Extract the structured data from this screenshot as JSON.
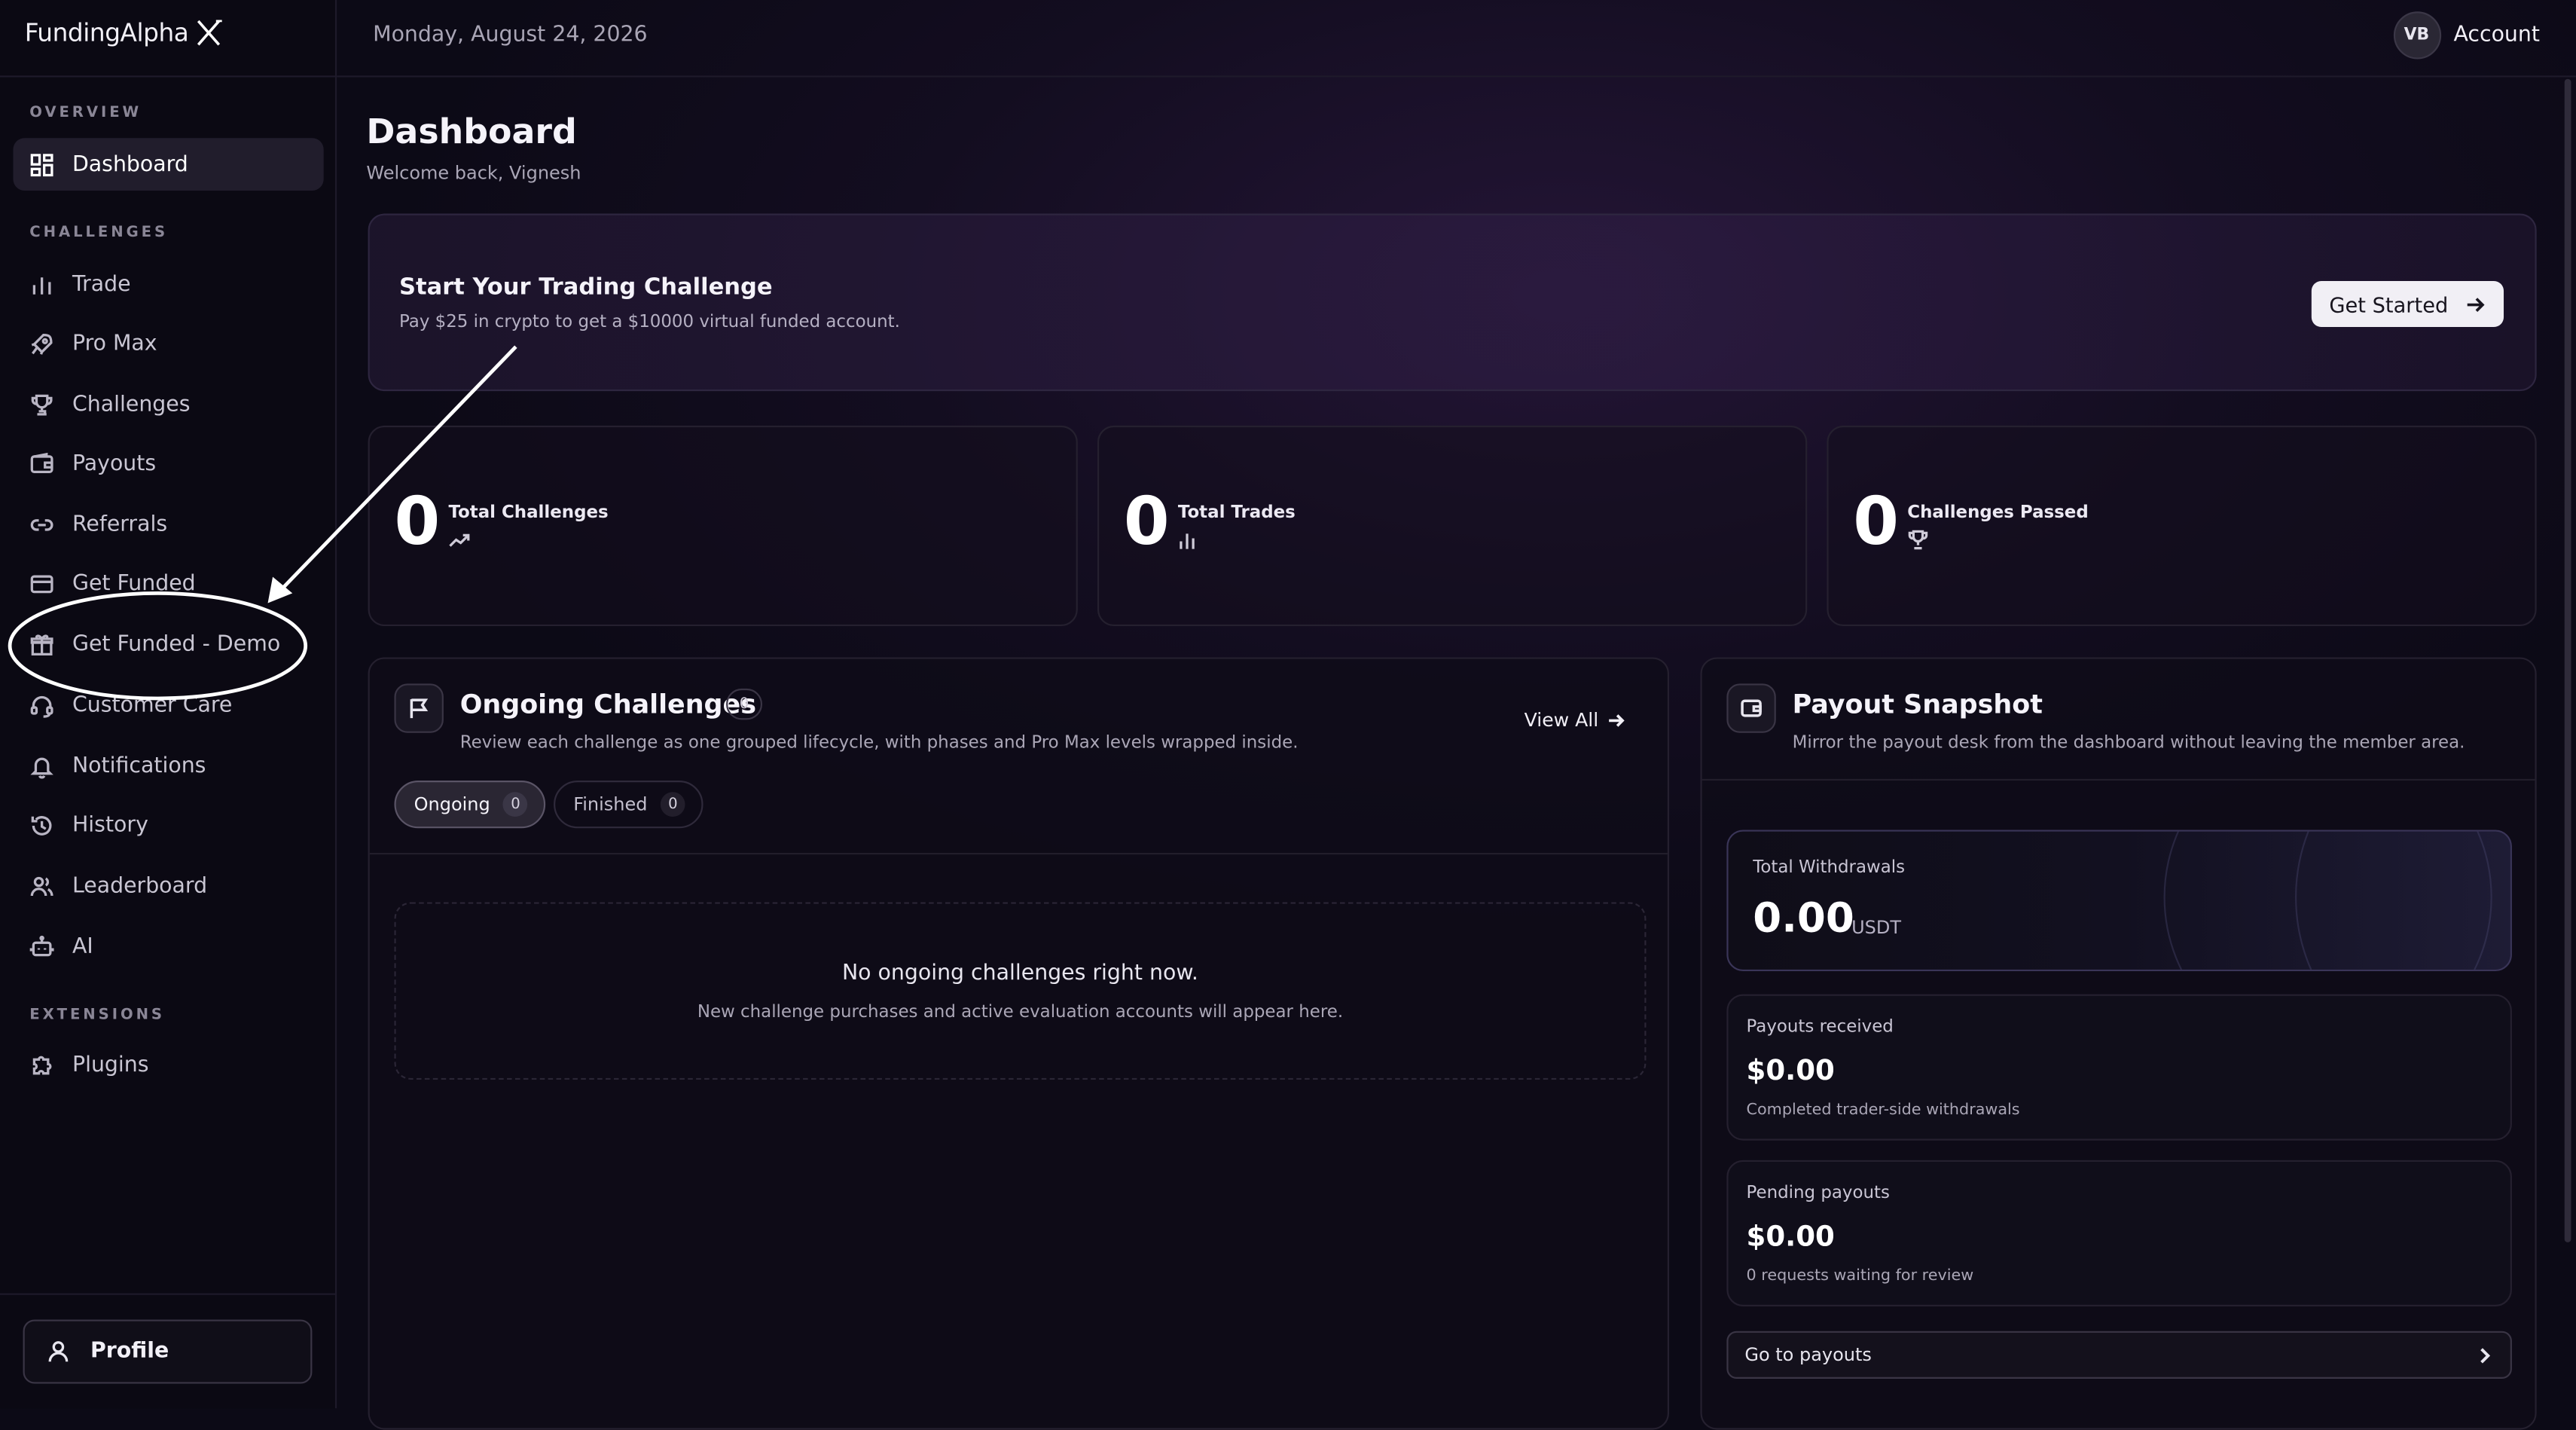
{
  "brand": {
    "name": "FundingAlpha",
    "logo_icon": "x-mark-icon"
  },
  "topbar": {
    "date": "Monday, August 24, 2026",
    "avatar_initials": "VB",
    "account_label": "Account"
  },
  "sidebar": {
    "sections": [
      {
        "label": "OVERVIEW"
      },
      {
        "label": "CHALLENGES"
      },
      {
        "label": "EXTENSIONS"
      }
    ],
    "items": [
      {
        "label": "Dashboard",
        "icon": "grid-icon",
        "active": true
      },
      {
        "label": "Trade",
        "icon": "bar-chart-icon"
      },
      {
        "label": "Pro Max",
        "icon": "rocket-icon"
      },
      {
        "label": "Challenges",
        "icon": "trophy-icon"
      },
      {
        "label": "Payouts",
        "icon": "wallet-icon"
      },
      {
        "label": "Referrals",
        "icon": "link-icon"
      },
      {
        "label": "Get Funded",
        "icon": "credit-card-icon"
      },
      {
        "label": "Get Funded - Demo",
        "icon": "gift-icon"
      },
      {
        "label": "Customer Care",
        "icon": "headset-icon"
      },
      {
        "label": "Notifications",
        "icon": "bell-icon"
      },
      {
        "label": "History",
        "icon": "history-icon"
      },
      {
        "label": "Leaderboard",
        "icon": "users-icon"
      },
      {
        "label": "AI",
        "icon": "bot-icon"
      },
      {
        "label": "Plugins",
        "icon": "puzzle-icon"
      }
    ],
    "profile_label": "Profile"
  },
  "main": {
    "title": "Dashboard",
    "subtitle": "Welcome back, Vignesh",
    "banner": {
      "title": "Start Your Trading Challenge",
      "subtitle": "Pay $25 in crypto to get a $10000 virtual funded account.",
      "button_label": "Get Started"
    },
    "stats": [
      {
        "value": "0",
        "label": "Total Challenges",
        "icon": "trending-up-icon"
      },
      {
        "value": "0",
        "label": "Total Trades",
        "icon": "bar-chart-icon"
      },
      {
        "value": "0",
        "label": "Challenges Passed",
        "icon": "trophy-icon"
      }
    ],
    "ongoing": {
      "title": "Ongoing Challenges",
      "count": "0",
      "subtitle": "Review each challenge as one grouped lifecycle, with phases and Pro Max levels wrapped inside.",
      "view_all": "View All",
      "tabs": [
        {
          "label": "Ongoing",
          "count": "0",
          "active": true
        },
        {
          "label": "Finished",
          "count": "0"
        }
      ],
      "empty_title": "No ongoing challenges right now.",
      "empty_subtitle": "New challenge purchases and active evaluation accounts will appear here."
    },
    "payout": {
      "title": "Payout Snapshot",
      "subtitle": "Mirror the payout desk from the dashboard without leaving the member area.",
      "total_label": "Total Withdrawals",
      "total_amount": "0.00",
      "total_unit": "USDT",
      "received": {
        "label": "Payouts received",
        "amount": "$0.00",
        "note": "Completed trader-side withdrawals"
      },
      "pending": {
        "label": "Pending payouts",
        "amount": "$0.00",
        "note": "0 requests waiting for review"
      },
      "go_label": "Go to payouts"
    }
  },
  "colors": {
    "background": "#0c0a16",
    "accent": "#241536",
    "annotation": "#ffffff"
  }
}
